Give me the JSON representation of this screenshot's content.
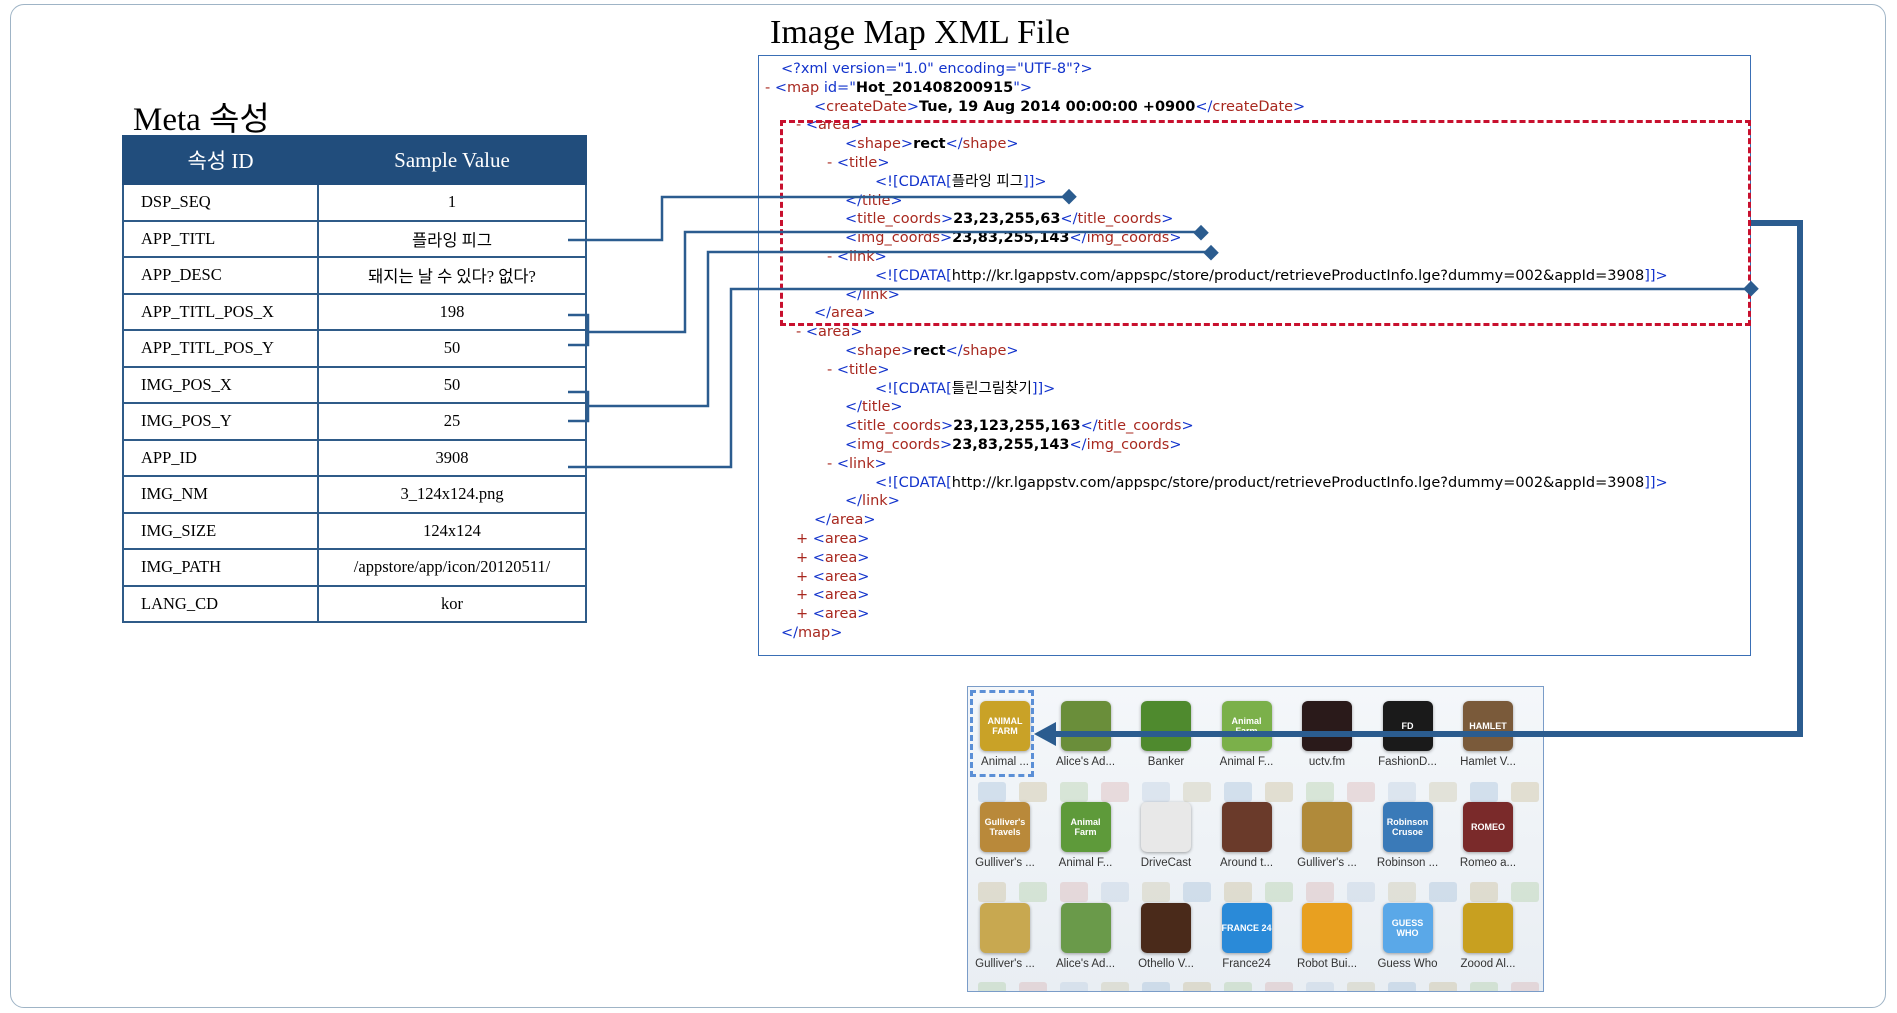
{
  "meta": {
    "title": "Meta 속성",
    "header": [
      "속성 ID",
      "Sample Value"
    ],
    "rows": [
      [
        "DSP_SEQ",
        "1"
      ],
      [
        "APP_TITL",
        "플라잉 피그"
      ],
      [
        "APP_DESC",
        "돼지는 날 수 있다? 없다?"
      ],
      [
        "APP_TITL_POS_X",
        "198"
      ],
      [
        "APP_TITL_POS_Y",
        "50"
      ],
      [
        "IMG_POS_X",
        "50"
      ],
      [
        "IMG_POS_Y",
        "25"
      ],
      [
        "APP_ID",
        "3908"
      ],
      [
        "IMG_NM",
        "3_124x124.png"
      ],
      [
        "IMG_SIZE",
        "124x124"
      ],
      [
        "IMG_PATH",
        "/appstore/app/icon/20120511/"
      ],
      [
        "LANG_CD",
        "kor"
      ]
    ]
  },
  "xml": {
    "title": "Image Map XML File",
    "decl": "<?xml version=\"1.0\" encoding=\"UTF-8\"?>",
    "map_id": "Hot_201408200915",
    "create_date": "Tue, 19 Aug 2014 00:00:00 +0900",
    "areas": [
      {
        "shape": "rect",
        "title": "플라잉 피그",
        "title_coords": "23,23,255,63",
        "img_coords": "23,83,255,143",
        "link": "http://kr.lgappstv.com/appspc/store/product/retrieveProductInfo.lge?dummy=002&appId=3908"
      },
      {
        "shape": "rect",
        "title": "틀린그림찾기",
        "title_coords": "23,123,255,163",
        "img_coords": "23,83,255,143",
        "link": "http://kr.lgappstv.com/appspc/store/product/retrieveProductInfo.lge?dummy=002&appId=3908"
      }
    ],
    "collapsed_count": 5
  },
  "apps": [
    {
      "label": "Animal ...",
      "icon": "ANIMAL FARM",
      "color": "#c9a227"
    },
    {
      "label": "Alice's Ad...",
      "icon": "",
      "color": "#6a8e3a"
    },
    {
      "label": "Banker",
      "icon": "",
      "color": "#4f8a2e"
    },
    {
      "label": "Animal F...",
      "icon": "Animal Farm",
      "color": "#7bb04a"
    },
    {
      "label": "uctv.fm",
      "icon": "",
      "color": "#2a1a1a"
    },
    {
      "label": "FashionD...",
      "icon": "FD",
      "color": "#1a1a1a"
    },
    {
      "label": "Hamlet V...",
      "icon": "HAMLET",
      "color": "#7a5a3a"
    },
    {
      "label": "Gulliver's ...",
      "icon": "Gulliver's Travels",
      "color": "#b9893a"
    },
    {
      "label": "Animal F...",
      "icon": "Animal Farm",
      "color": "#5e9a3a"
    },
    {
      "label": "DriveCast",
      "icon": "",
      "color": "#e8e8e8"
    },
    {
      "label": "Around t...",
      "icon": "",
      "color": "#6a3a2a"
    },
    {
      "label": "Gulliver's ...",
      "icon": "",
      "color": "#b08a3a"
    },
    {
      "label": "Robinson ...",
      "icon": "Robinson Crusoe",
      "color": "#3a7ab8"
    },
    {
      "label": "Romeo a...",
      "icon": "ROMEO",
      "color": "#7a2a2a"
    },
    {
      "label": "Gulliver's ...",
      "icon": "",
      "color": "#c8a850"
    },
    {
      "label": "Alice's Ad...",
      "icon": "",
      "color": "#6a9a4a"
    },
    {
      "label": "Othello V...",
      "icon": "",
      "color": "#4a2a1a"
    },
    {
      "label": "France24",
      "icon": "FRANCE 24",
      "color": "#2a8ad8"
    },
    {
      "label": "Robot Bui...",
      "icon": "",
      "color": "#e8a020"
    },
    {
      "label": "Guess Who",
      "icon": "GUESS WHO",
      "color": "#5aa8e8"
    },
    {
      "label": "Zoood Al...",
      "icon": "",
      "color": "#c8a020"
    }
  ],
  "colors": {
    "header_bg": "#214d7c",
    "connector": "#2b5c8f",
    "highlight": "#c8102e",
    "tag": "#a8281f",
    "punct": "#1233cc"
  }
}
